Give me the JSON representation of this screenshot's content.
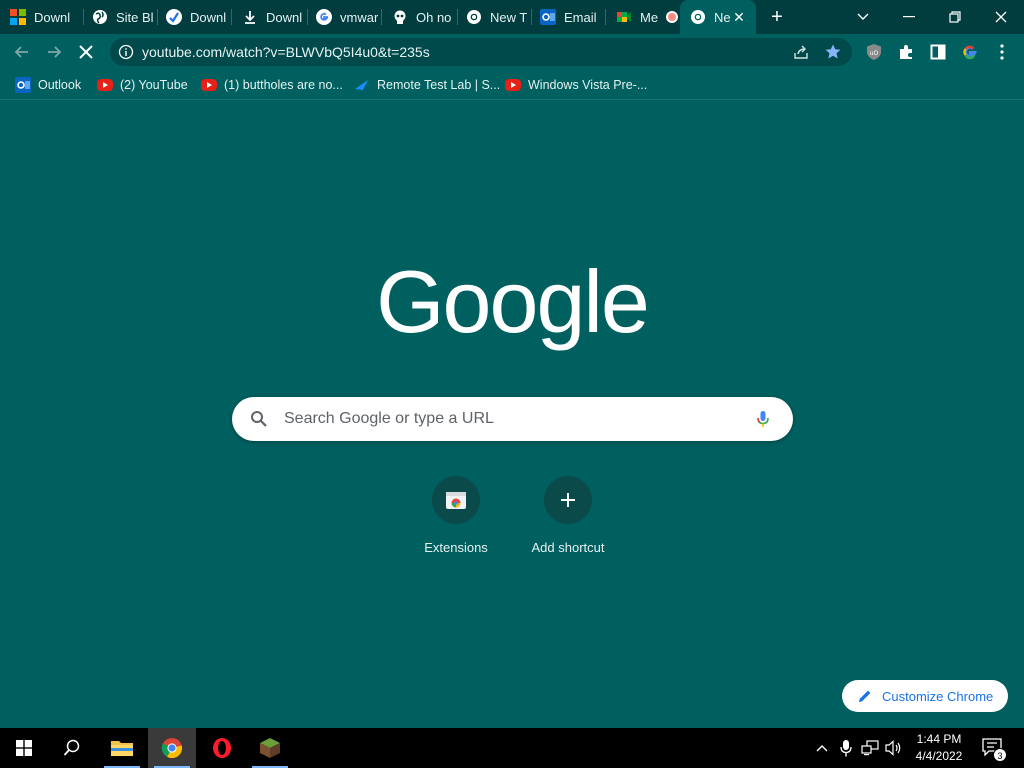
{
  "browser": {
    "tabs": [
      {
        "label": "Downl",
        "icon": "microsoft-logo-icon"
      },
      {
        "label": "Site Bl",
        "icon": "globe-icon"
      },
      {
        "label": "Downl",
        "icon": "checkmark-circle-icon"
      },
      {
        "label": "Downl",
        "icon": "download-icon"
      },
      {
        "label": "vmwar",
        "icon": "google-g-icon"
      },
      {
        "label": "Oh no",
        "icon": "skull-icon"
      },
      {
        "label": "New T",
        "icon": "chrome-icon"
      },
      {
        "label": "Email",
        "icon": "outlook-icon"
      },
      {
        "label": "Me",
        "icon": "meet-icon"
      },
      {
        "label": "Ne",
        "icon": "chrome-icon",
        "active": true
      }
    ],
    "new_tab_symbol": "+",
    "address": "youtube.com/watch?v=BLWVbQ5I4u0&t=235s",
    "bookmarks": [
      {
        "label": "Outlook",
        "icon": "outlook-icon"
      },
      {
        "label": "(2) YouTube",
        "icon": "youtube-icon"
      },
      {
        "label": "(1) buttholes are no...",
        "icon": "youtube-icon"
      },
      {
        "label": "Remote Test Lab | S...",
        "icon": "remote-lab-icon"
      },
      {
        "label": "Windows Vista Pre-...",
        "icon": "youtube-icon"
      }
    ]
  },
  "newtab": {
    "logo_text": "Google",
    "search_placeholder": "Search Google or type a URL",
    "shortcuts": [
      {
        "label": "Extensions",
        "icon": "extensions-store-icon"
      },
      {
        "label": "Add shortcut",
        "icon": "plus-icon"
      }
    ],
    "customize_label": "Customize Chrome"
  },
  "taskbar": {
    "time": "1:44 PM",
    "date": "4/4/2022",
    "notification_count": "3"
  },
  "colors": {
    "theme_bg": "#005f5f",
    "tabstrip_bg": "#013d3f",
    "accent_blue": "#1a73e8"
  }
}
